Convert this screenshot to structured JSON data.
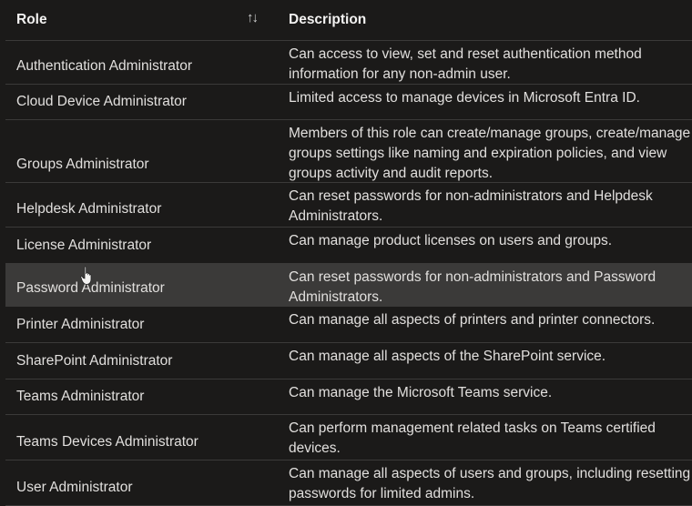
{
  "header": {
    "role": "Role",
    "description": "Description",
    "sort_icon": "sort-arrows-icon"
  },
  "rows": [
    {
      "role": "Authentication Administrator",
      "description": "Can access to view, set and reset authentication method information for any non-admin user."
    },
    {
      "role": "Cloud Device Administrator",
      "description": "Limited access to manage devices in Microsoft Entra ID."
    },
    {
      "role": "Groups Administrator",
      "description": "Members of this role can create/manage groups, create/manage groups settings like naming and expiration policies, and view groups activity and audit reports."
    },
    {
      "role": "Helpdesk Administrator",
      "description": "Can reset passwords for non-administrators and Helpdesk Administrators."
    },
    {
      "role": "License Administrator",
      "description": "Can manage product licenses on users and groups."
    },
    {
      "role": "Password Administrator",
      "description": "Can reset passwords for non-administrators and Password Administrators."
    },
    {
      "role": "Printer Administrator",
      "description": "Can manage all aspects of printers and printer connectors."
    },
    {
      "role": "SharePoint Administrator",
      "description": "Can manage all aspects of the SharePoint service."
    },
    {
      "role": "Teams Administrator",
      "description": "Can manage the Microsoft Teams service."
    },
    {
      "role": "Teams Devices Administrator",
      "description": "Can perform management related tasks on Teams certified devices."
    },
    {
      "role": "User Administrator",
      "description": "Can manage all aspects of users and groups, including resetting passwords for limited admins."
    }
  ]
}
